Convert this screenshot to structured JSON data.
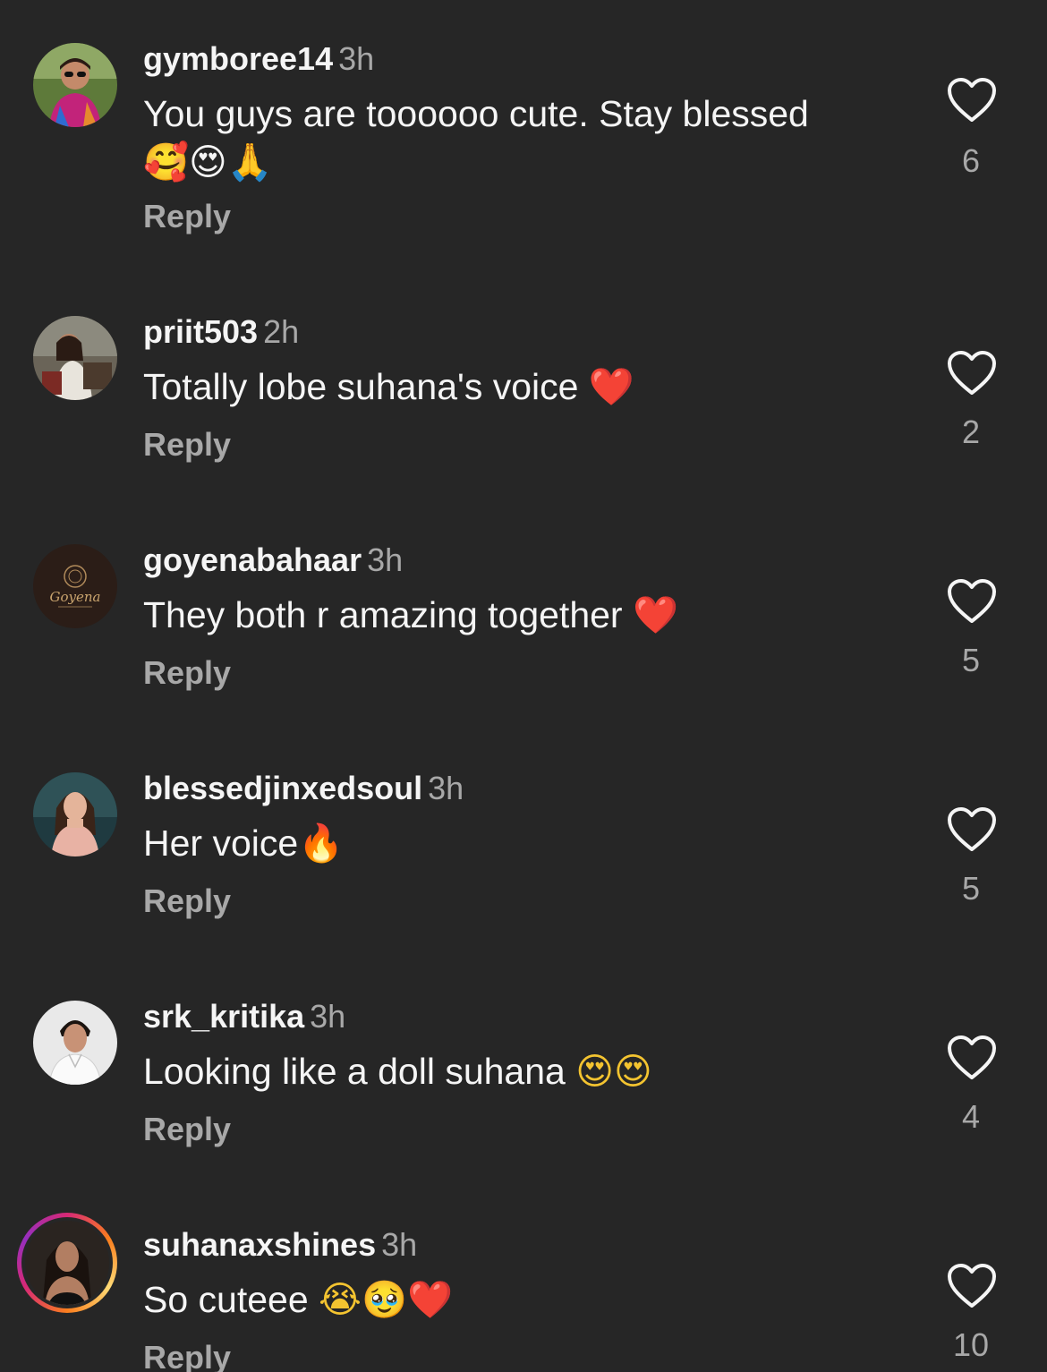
{
  "comments": [
    {
      "username": "gymboree14",
      "time": "3h",
      "text": "You guys are toooooo cute. Stay blessed",
      "emojis": "🥰😍🙏",
      "reply_label": "Reply",
      "likes": "6",
      "avatar": "avatar-woman-sunglasses"
    },
    {
      "username": "priit503",
      "time": "2h",
      "text": "Totally lobe suhana's voice",
      "emojis": "❤️",
      "reply_label": "Reply",
      "likes": "2",
      "avatar": "avatar-woman-seated"
    },
    {
      "username": "goyenabahaar",
      "time": "3h",
      "text": "They both r amazing together",
      "emojis": "❤️",
      "reply_label": "Reply",
      "likes": "5",
      "avatar": "avatar-goyena-logo",
      "avatar_text": "Goyena"
    },
    {
      "username": "blessedjinxedsoul",
      "time": "3h",
      "text": "Her voice",
      "emojis": "🔥",
      "reply_label": "Reply",
      "likes": "5",
      "avatar": "avatar-woman-pink"
    },
    {
      "username": "srk_kritika",
      "time": "3h",
      "text": "Looking like a doll suhana",
      "emojis": "😍😍",
      "reply_label": "Reply",
      "likes": "4",
      "avatar": "avatar-man-white-shirt"
    },
    {
      "username": "suhanaxshines",
      "time": "3h",
      "text": "So cuteee",
      "emojis": "😭🥹❤️",
      "reply_label": "Reply",
      "likes": "10",
      "avatar": "avatar-woman-story-ring"
    }
  ],
  "colors": {
    "background": "#262626",
    "primary_text": "#f5f5f5",
    "secondary_text": "#a8a8a8"
  },
  "icons": {
    "like": "heart-outline-icon"
  }
}
